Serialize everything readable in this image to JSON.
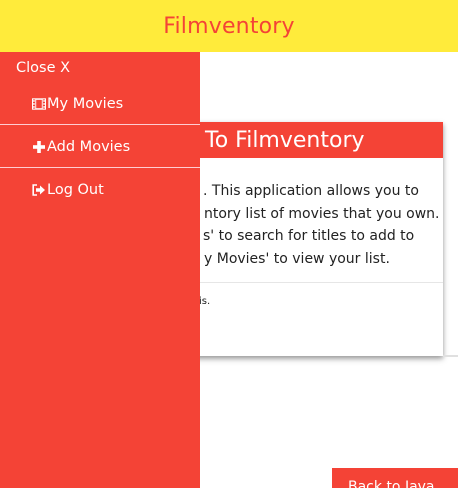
{
  "header": {
    "title": "Filmventory"
  },
  "card": {
    "title_visible": "To Filmventory",
    "body_lines": [
      ". This application allows you to",
      "ntory list of movies that you own.",
      "s' to search for titles to add to",
      "y Movies' to view your list."
    ],
    "footer_fragment": "is."
  },
  "back_button": {
    "label": "Back to Java"
  },
  "sidenav": {
    "close_label": "Close X",
    "items": [
      {
        "label": "My Movies",
        "icon": "film-icon"
      },
      {
        "label": "Add Movies",
        "icon": "plus-icon"
      },
      {
        "label": "Log Out",
        "icon": "logout-icon"
      }
    ]
  },
  "colors": {
    "header_bg": "#ffeb3b",
    "accent": "#f44336",
    "text_on_accent": "#ffffff"
  }
}
